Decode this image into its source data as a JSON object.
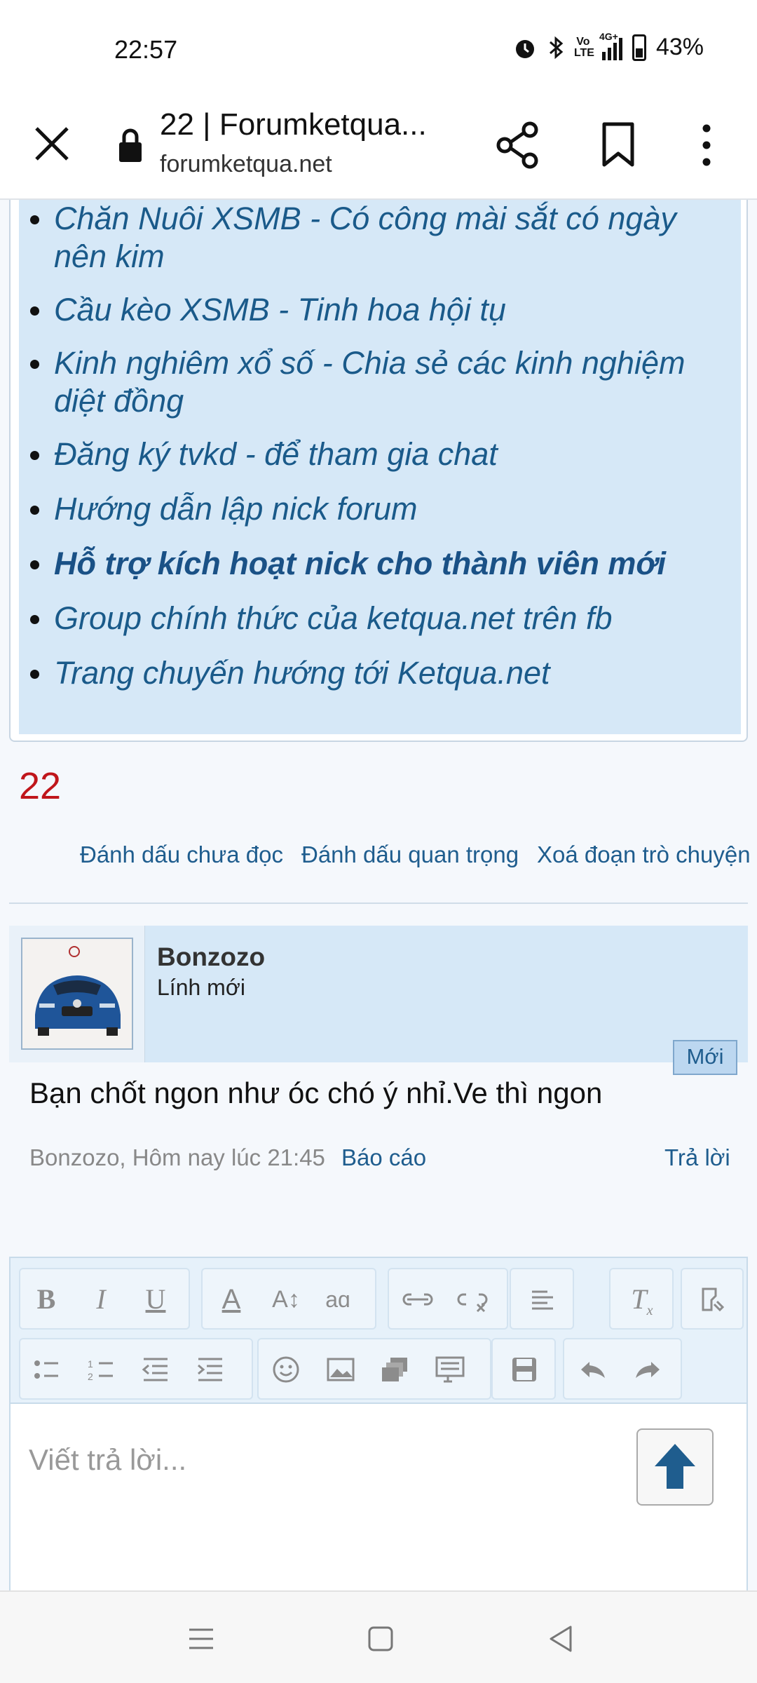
{
  "status_bar": {
    "time": "22:57",
    "battery": "43%",
    "volte_top": "Vo",
    "volte_bottom": "LTE",
    "network": "4G+"
  },
  "browser": {
    "title": "22 | Forumketqua...",
    "url": "forumketqua.net"
  },
  "links": [
    "Chăn Nuôi XSMB - Có công mài sắt có ngày nên kim",
    "Cầu kèo XSMB - Tinh hoa hội tụ",
    "Kinh nghiêm xổ số - Chia sẻ các kinh nghiệm diệt đồng",
    "Đăng ký tvkd - để tham gia chat",
    "Hướng dẫn lập nick forum",
    "Hỗ trợ kích hoạt nick cho thành viên mới",
    "Group chính thức của ketqua.net trên fb",
    "Trang chuyến hướng tới Ketqua.net"
  ],
  "thread": {
    "title": "22",
    "actions": [
      "Đánh dấu chưa đọc",
      "Đánh dấu quan trọng",
      "Xoá đoạn trò chuyện"
    ]
  },
  "post": {
    "username": "Bonzozo",
    "rank": "Lính mới",
    "badge": "Mới",
    "body": "Bạn chốt ngon như óc chó ý nhỉ.Ve thì ngon",
    "meta": "Bonzozo, Hôm nay lúc 21:45",
    "report": "Báo cáo",
    "reply": "Trả lời"
  },
  "editor": {
    "placeholder": "Viết trả lời..."
  },
  "colors": {
    "link": "#1a5a8a",
    "title_red": "#c0161b",
    "panel_blue": "#d6e8f7"
  }
}
